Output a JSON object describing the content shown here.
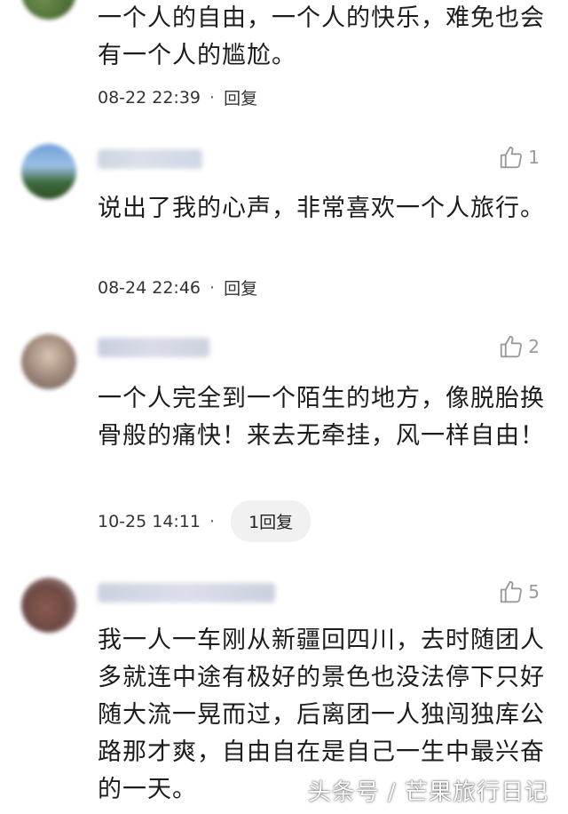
{
  "comments": [
    {
      "text": "一个人的自由，一个人的快乐，难免也会有一个人的尴尬。",
      "time": "08-22 22:39",
      "reply": "回复"
    },
    {
      "likes": "1",
      "text": "说出了我的心声，非常喜欢一个人旅行。",
      "time": "08-24 22:46",
      "reply": "回复"
    },
    {
      "likes": "2",
      "text": "一个人完全到一个陌生的地方，像脱胎换骨般的痛快！来去无牵挂，风一样自由！",
      "time": "10-25 14:11",
      "reply": "1回复"
    },
    {
      "likes": "5",
      "text": "我一人一车刚从新疆回四川，去时随团人多就连中途有极好的景色也没法停下只好随大流一晃而过，后离团一人独闯独库公路那才爽，自由自在是自己一生中最兴奋的一天。"
    }
  ],
  "separator": "·",
  "watermark": "头条号 / 芒果旅行日记",
  "icons": {
    "like": "thumbs-up-icon"
  },
  "colors": {
    "muted": "#9a9a9a",
    "pill": "#f1f1f1"
  }
}
